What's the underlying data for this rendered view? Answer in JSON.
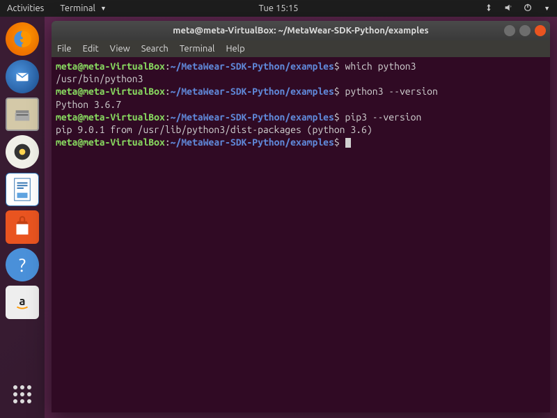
{
  "topbar": {
    "activities": "Activities",
    "app": "Terminal",
    "clock": "Tue 15:15"
  },
  "window": {
    "title": "meta@meta-VirtualBox: ~/MetaWear-SDK-Python/examples"
  },
  "menubar": {
    "file": "File",
    "edit": "Edit",
    "view": "View",
    "search": "Search",
    "terminal": "Terminal",
    "help": "Help"
  },
  "prompt": {
    "user_host": "meta@meta-VirtualBox",
    "colon": ":",
    "path": "~/MetaWear-SDK-Python/examples",
    "dollar": "$"
  },
  "lines": {
    "cmd1": " which python3",
    "out1": "/usr/bin/python3",
    "cmd2": " python3 --version",
    "out2": "Python 3.6.7",
    "cmd3": " pip3 --version",
    "out3": "pip 9.0.1 from /usr/lib/python3/dist-packages (python 3.6)",
    "cmd4": " "
  }
}
